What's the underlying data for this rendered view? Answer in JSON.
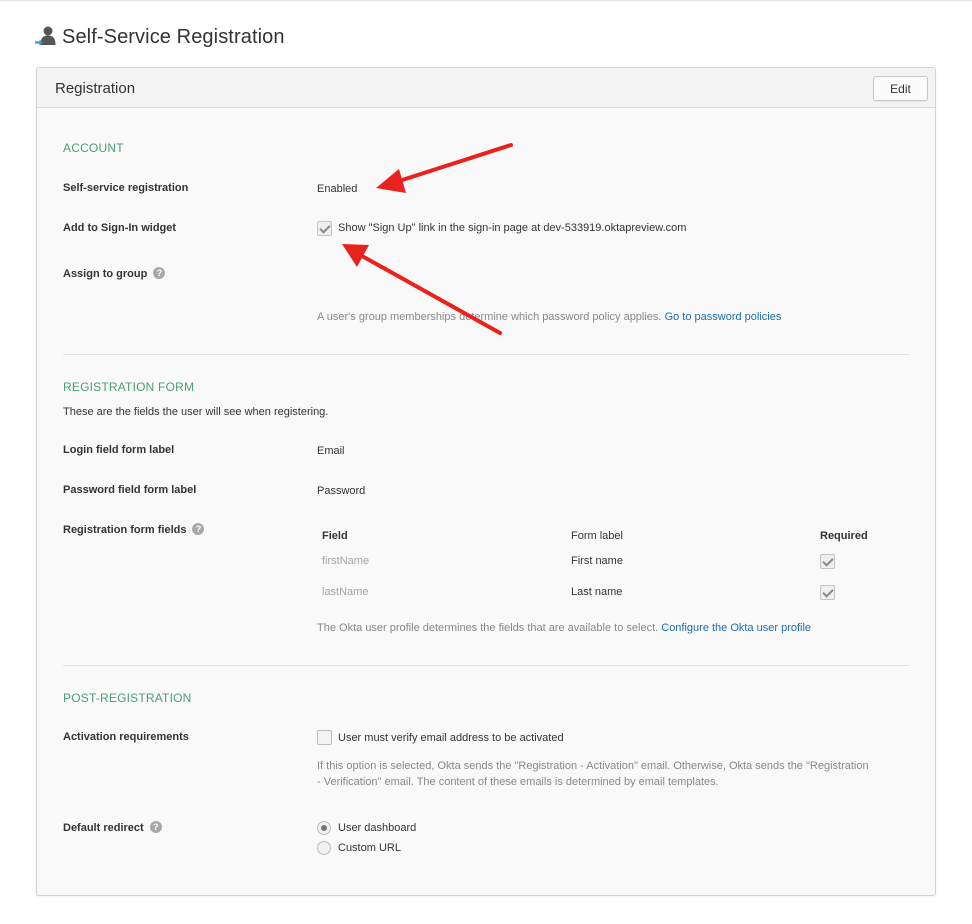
{
  "page": {
    "title": "Self-Service Registration",
    "icon": "user-arrow-icon"
  },
  "panel": {
    "title": "Registration",
    "edit_label": "Edit"
  },
  "account": {
    "section_title": "ACCOUNT",
    "self_service_label": "Self-service registration",
    "self_service_value": "Enabled",
    "widget_label": "Add to Sign-In widget",
    "widget_checkbox_label": "Show \"Sign Up\" link in the sign-in page at dev-533919.oktapreview.com",
    "widget_checked": true,
    "group_label": "Assign to group",
    "group_note": "A user's group memberships determine which password policy applies.",
    "group_link": "Go to password policies"
  },
  "registration_form": {
    "section_title": "REGISTRATION FORM",
    "description": "These are the fields the user will see when registering.",
    "login_label": "Login field form label",
    "login_value": "Email",
    "password_label": "Password field form label",
    "password_value": "Password",
    "fields_label": "Registration form fields",
    "columns": {
      "field": "Field",
      "form_label": "Form label",
      "required": "Required"
    },
    "rows": [
      {
        "field": "firstName",
        "form_label": "First name",
        "required": true
      },
      {
        "field": "lastName",
        "form_label": "Last name",
        "required": true
      }
    ],
    "note": "The Okta user profile determines the fields that are available to select.",
    "note_link": "Configure the Okta user profile"
  },
  "post_registration": {
    "section_title": "POST-REGISTRATION",
    "activation_label": "Activation requirements",
    "activation_checkbox_label": "User must verify email address to be activated",
    "activation_checked": false,
    "activation_note_line1": "If this option is selected, Okta sends the \"Registration - Activation\" email. Otherwise, Okta sends the \"Registration",
    "activation_note_line2": "- Verification\" email. The content of these emails is determined by email templates.",
    "redirect_label": "Default redirect",
    "redirect_options": [
      "User dashboard",
      "Custom URL"
    ],
    "redirect_selected": "User dashboard"
  },
  "colors": {
    "section_title": "#4a9e76",
    "link": "#1d6eaa",
    "annotation_arrow": "#e8231e"
  }
}
